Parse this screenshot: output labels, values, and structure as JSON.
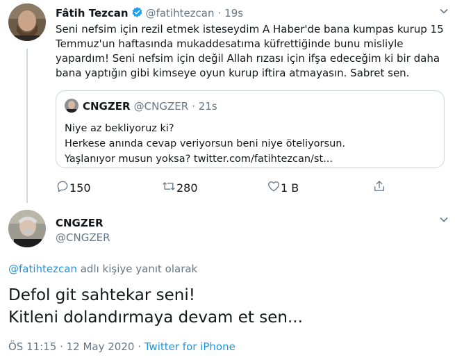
{
  "tweet": {
    "author_name": "Fâtih Tezcan",
    "author_handle": "@fatihtezcan",
    "time": "· 19s",
    "text": "Seni nefsim için rezil etmek isteseydim A Haber'de bana kumpas kurup 15\nTemmuz'un haftasında mukaddesatıma küfrettiğinde bunu misliyle\nyapardım! Seni nefsim için değil Allah rızası için ifşa edeceğim ki bir daha\nbana yaptığın gibi kimseye oyun kurup iftira atmayasın. Sabret sen.",
    "quote": {
      "author_name": "CNGZER",
      "author_handle": "@CNGZER",
      "time": "· 21s",
      "text": "Niye az bekliyoruz ki?\nHerkese anında cevap veriyorsun beni niye öteliyorsun.\nYaşlanıyor musun yoksa? twitter.com/fatihtezcan/st..."
    },
    "actions": {
      "reply_count": "150",
      "retweet_count": "280",
      "like_count": "1 B",
      "reply_icon": "reply-icon",
      "retweet_icon": "retweet-icon",
      "like_icon": "heart-icon",
      "share_icon": "share-icon"
    }
  },
  "reply": {
    "author_name": "CNGZER",
    "author_handle": "@CNGZER",
    "reply_mention": "@fatihtezcan",
    "reply_suffix": " adlı kişiye yanıt olarak",
    "text": "Defol git sahtekar seni!\nKitleni dolandırmaya devam et sen...",
    "timestamp": "ÖS 11:15 · 12 May 2020 · ",
    "source": "Twitter for iPhone"
  },
  "colors": {
    "verified": "#1da1f2",
    "secondary_text": "#657786",
    "link": "#1b95e0",
    "border": "#ccd6dd"
  }
}
